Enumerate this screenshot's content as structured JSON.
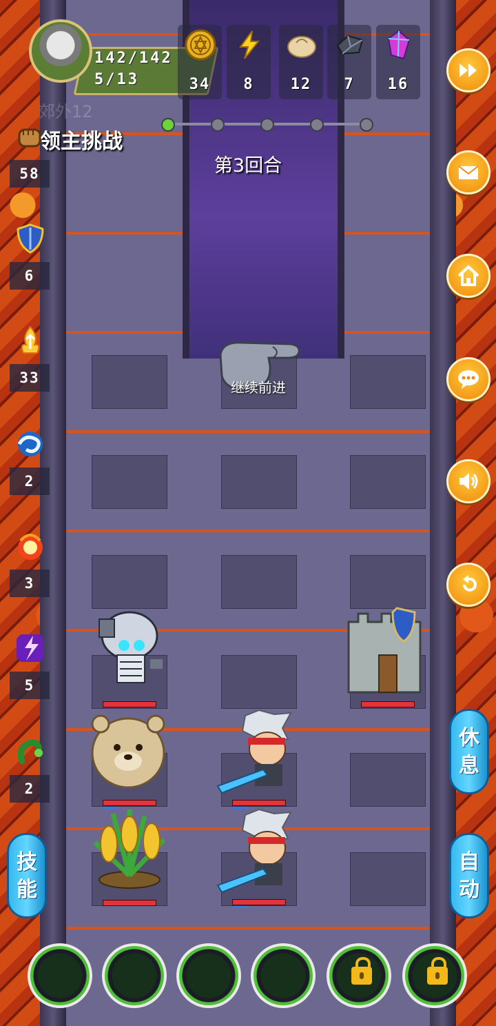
{
  "player": {
    "hp": "142/142",
    "level": "5/13",
    "avatar_icon": "hero-avatar-icon"
  },
  "resources": [
    {
      "name": "gold-coin-icon",
      "value": "34"
    },
    {
      "name": "energy-icon",
      "value": "8"
    },
    {
      "name": "bun-icon",
      "value": "12"
    },
    {
      "name": "iron-ore-icon",
      "value": "7"
    },
    {
      "name": "crystal-icon",
      "value": "16"
    }
  ],
  "stage": {
    "ghost_text": "郊外12",
    "title": "领主挑战",
    "round": "第3回合",
    "progress_total": 5,
    "progress_done": 1
  },
  "buffs": [
    {
      "icon": "fist-icon",
      "value": "58"
    },
    {
      "icon": "shield-icon",
      "value": "6"
    },
    {
      "icon": "flame-up-icon",
      "value": "33"
    },
    {
      "icon": "water-swirl-icon",
      "value": "2"
    },
    {
      "icon": "fireball-icon",
      "value": "3"
    },
    {
      "icon": "purple-lightning-icon",
      "value": "5"
    },
    {
      "icon": "green-worm-icon",
      "value": "2"
    }
  ],
  "right_buttons": [
    "fast-forward-icon",
    "mail-icon",
    "home-icon",
    "chat-icon",
    "sound-icon",
    "return-icon"
  ],
  "actions": {
    "rest": [
      "休",
      "息"
    ],
    "auto": [
      "自",
      "动"
    ],
    "skill": [
      "技",
      "能"
    ]
  },
  "continue_label": "继续前进",
  "units": [
    {
      "name": "skeleton-enemy",
      "hp": 1.0
    },
    {
      "name": "tower-enemy",
      "hp": 1.0
    },
    {
      "name": "bear-enemy",
      "hp": 1.0
    },
    {
      "name": "hero-unit-1",
      "hp": 1.0
    },
    {
      "name": "corn-plant-unit",
      "hp": 1.0
    },
    {
      "name": "hero-unit-2",
      "hp": 1.0
    }
  ],
  "skill_slots": [
    {
      "locked": false
    },
    {
      "locked": false
    },
    {
      "locked": false
    },
    {
      "locked": false
    },
    {
      "locked": true
    },
    {
      "locked": true
    }
  ],
  "colors": {
    "accent_orange": "#f39a1c",
    "pill_blue": "#37b9ef",
    "hp_red": "#e2343a",
    "progress_green": "#6cd33a"
  }
}
